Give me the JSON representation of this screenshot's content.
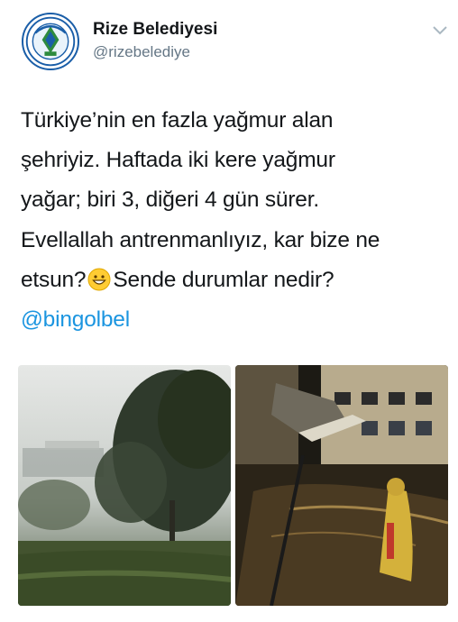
{
  "author": {
    "name": "Rize Belediyesi",
    "handle": "@rizebelediye",
    "avatar_icon": "rize-municipality-logo"
  },
  "menu_icon": "chevron-down-icon",
  "tweet": {
    "lines": [
      "Türkiye’nin en fazla yağmur alan",
      "şehriyiz. Haftada iki kere yağmur",
      "yağar; biri 3, diğeri 4 gün sürer.",
      "Evellallah antrenmanlıyız, kar bize ne",
      "etsun?",
      "Sende durumlar nedir?"
    ],
    "emoji": "grinning-face-emoji",
    "mention": "@bingolbel"
  },
  "media": [
    {
      "name": "misty-tea-garden-photo"
    },
    {
      "name": "flooded-street-photo"
    }
  ],
  "colors": {
    "link": "#1b95e0",
    "secondary_text": "#657786",
    "logo_blue": "#1a5ea8",
    "logo_green": "#2e8b3e"
  }
}
